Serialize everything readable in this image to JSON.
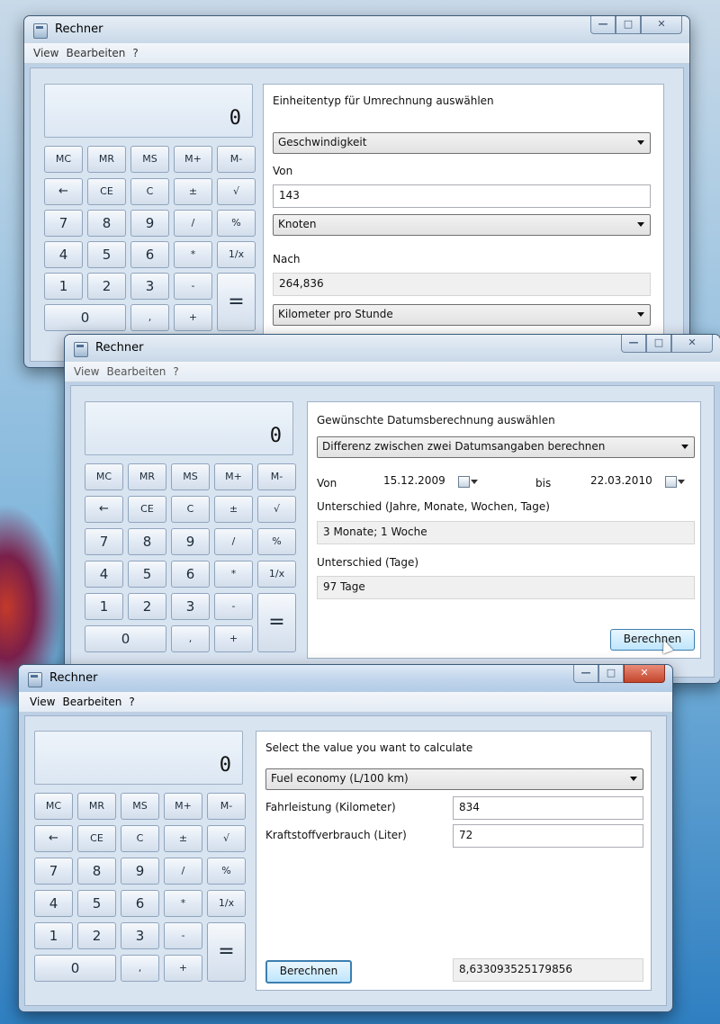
{
  "colors": {
    "window_frame": "#bcd0e6",
    "button_face": "#e2eaf4",
    "close_red": "#c4452c",
    "accent_blue": "#3c7fb1"
  },
  "keypad": {
    "row1": [
      "MC",
      "MR",
      "MS",
      "M+",
      "M-"
    ],
    "row2": [
      "←",
      "CE",
      "C",
      "±",
      "√"
    ],
    "row3": [
      "7",
      "8",
      "9",
      "/",
      "%"
    ],
    "row4": [
      "4",
      "5",
      "6",
      "*",
      "1/x"
    ],
    "row5": [
      "1",
      "2",
      "3",
      "-"
    ],
    "row6": [
      "0",
      ",",
      "+"
    ],
    "equals": "="
  },
  "window1": {
    "title": "Rechner",
    "menu": [
      "View",
      "Bearbeiten",
      "?"
    ],
    "display": "0",
    "panel_title": "Einheitentyp für Umrechnung auswählen",
    "unit_type": "Geschwindigkeit",
    "from_label": "Von",
    "from_value": "143",
    "from_unit": "Knoten",
    "to_label": "Nach",
    "to_value": "264,836",
    "to_unit": "Kilometer pro Stunde"
  },
  "window2": {
    "title": "Rechner",
    "menu": [
      "View",
      "Bearbeiten",
      "?"
    ],
    "display": "0",
    "panel_title": "Gewünschte Datumsberechnung auswählen",
    "calc_type": "Differenz zwischen zwei Datumsangaben berechnen",
    "from_label": "Von",
    "from_date": "15.12.2009",
    "to_label": "bis",
    "to_date": "22.03.2010",
    "diff_label": "Unterschied (Jahre, Monate, Wochen, Tage)",
    "diff_value": "3 Monate; 1 Woche",
    "days_label": "Unterschied (Tage)",
    "days_value": "97 Tage",
    "calc_button": "Berechnen"
  },
  "window3": {
    "title": "Rechner",
    "menu": [
      "View",
      "Bearbeiten",
      "?"
    ],
    "display": "0",
    "panel_title": "Select the value you want to calculate",
    "calc_type": "Fuel economy (L/100 km)",
    "distance_label": "Fahrleistung (Kilometer)",
    "distance_value": "834",
    "fuel_label": "Kraftstoffverbrauch (Liter)",
    "fuel_value": "72",
    "calc_button": "Berechnen",
    "result_value": "8,633093525179856"
  }
}
